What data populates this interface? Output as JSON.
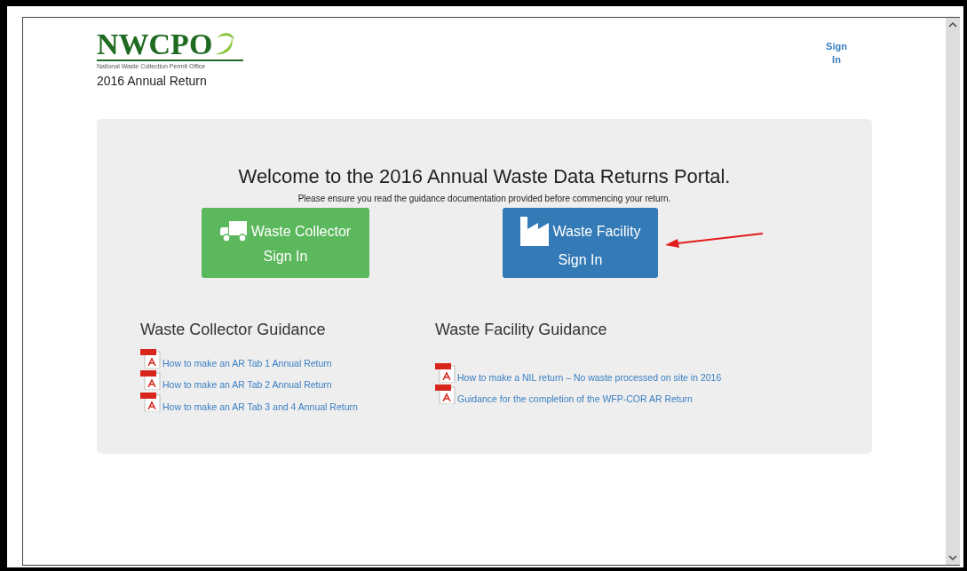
{
  "logo": {
    "wordmark": "NWCPO",
    "tagline": "National Waste Collection Permit Office"
  },
  "subtitle": "2016 Annual Return",
  "header_link": {
    "label": "Sign In"
  },
  "welcome": {
    "heading": "Welcome to the 2016 Annual Waste Data Returns Portal.",
    "note": "Please ensure you read the guidance documentation provided before commencing your return."
  },
  "sign_in_buttons": [
    {
      "kind": "collector",
      "line1": "Waste Collector",
      "line2": "Sign In"
    },
    {
      "kind": "facility",
      "line1": "Waste Facility",
      "line2": "Sign In"
    }
  ],
  "guidance": [
    {
      "title": "Waste Collector Guidance",
      "links": [
        "How to make an AR Tab 1 Annual Return",
        "How to make an AR Tab 2 Annual Return",
        "How to make an AR Tab 3 and 4 Annual Return"
      ]
    },
    {
      "title": "Waste Facility Guidance",
      "links": [
        "How to make a NIL return – No waste processed on site in 2016",
        "Guidance for the completion of the WFP-COR AR Return"
      ]
    }
  ]
}
